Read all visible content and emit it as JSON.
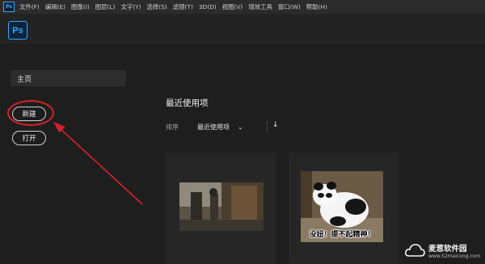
{
  "menu": {
    "app_icon": "Ps",
    "items": [
      "文件(F)",
      "编辑(E)",
      "图像(I)",
      "图层(L)",
      "文字(Y)",
      "选择(S)",
      "滤镜(T)",
      "3D(D)",
      "视图(V)",
      "增效工具",
      "窗口(W)",
      "帮助(H)"
    ]
  },
  "header": {
    "logo": "Ps"
  },
  "sidebar": {
    "home_label": "主页",
    "new_button": "新建",
    "open_button": "打开"
  },
  "main": {
    "section_title": "最近使用项",
    "sort_label": "排序",
    "sort_value": "最近使用项",
    "sort_chevron": "⌄",
    "sort_direction": "↓"
  },
  "recent_files": [
    {
      "thumbnail": "street-photo"
    },
    {
      "thumbnail": "panda-meme",
      "caption": "没妞！提不起精神！"
    }
  ],
  "watermark": {
    "name": "麦葱软件园",
    "url": "www.52maicong.com"
  },
  "colors": {
    "accent": "#31a8ff",
    "annotation_red": "#d2232a",
    "background": "#1e1e1e"
  },
  "icons": [
    "photoshop-logo-icon",
    "chevron-down-icon",
    "arrow-down-icon",
    "cloud-logo-icon"
  ]
}
